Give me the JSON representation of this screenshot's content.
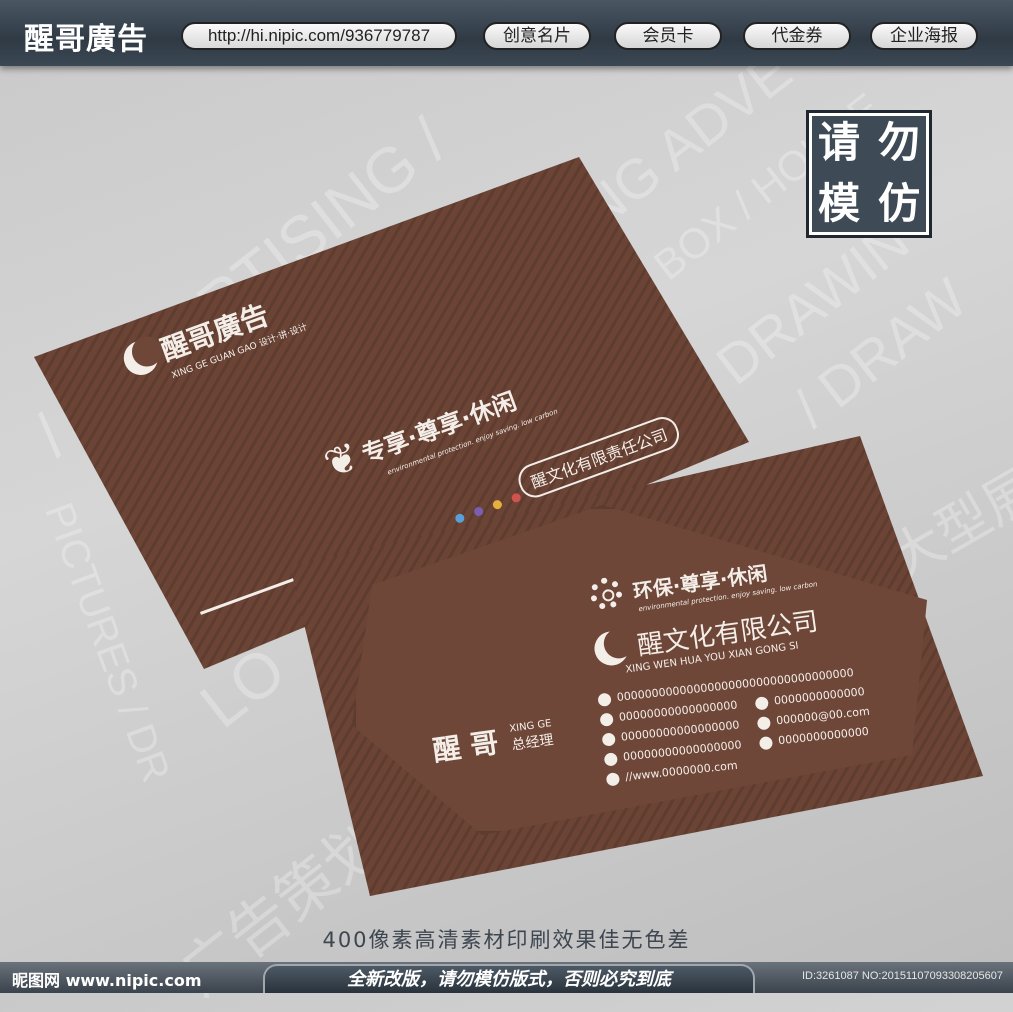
{
  "header": {
    "logo_text": "醒哥廣告",
    "url": "http://hi.nipic.com/936779787",
    "nav": [
      "创意名片",
      "会员卡",
      "代金券",
      "企业海报"
    ]
  },
  "stamp": {
    "chars": [
      "请",
      "勿",
      "模",
      "仿"
    ]
  },
  "card_back": {
    "logo_text": "醒哥廣告",
    "logo_sub": "XING GE GUAN GAO 设计·讲·设计",
    "slogan": "专享·尊享·休闲",
    "slogan_sub": "environmental protection. enjoy saving. low carbon",
    "company_pill": "醒文化有限责任公司"
  },
  "card_front": {
    "slogan": "环保·尊享·休闲",
    "slogan_sub": "environmental protection. enjoy saving. low carbon",
    "company": "醒文化有限公司",
    "company_pinyin": "XING WEN HUA YOU XIAN GONG SI",
    "address": "0000000000000000000000000000000000",
    "phone": "00000000000000000",
    "mobile": "0000000000000",
    "tel": "00000000000000000",
    "email": "000000@00.com",
    "fax": "00000000000000000",
    "qq": "0000000000000",
    "website": "//www.0000000.com",
    "name": "醒 哥",
    "name_pinyin": "XING GE",
    "title": "总经理"
  },
  "footer": {
    "caption": "400像素高清素材印刷效果佳无色差",
    "banner": "全新改版，请勿模仿版式，否则必究到底",
    "site": "昵图网 www.nipic.com",
    "image_id": "ID:3261087 NO:20151107093308205607"
  },
  "colors": {
    "card_brown": "#6b4436",
    "header_dark": "#2f3a45",
    "stamp_bg": "#3e4a56"
  }
}
